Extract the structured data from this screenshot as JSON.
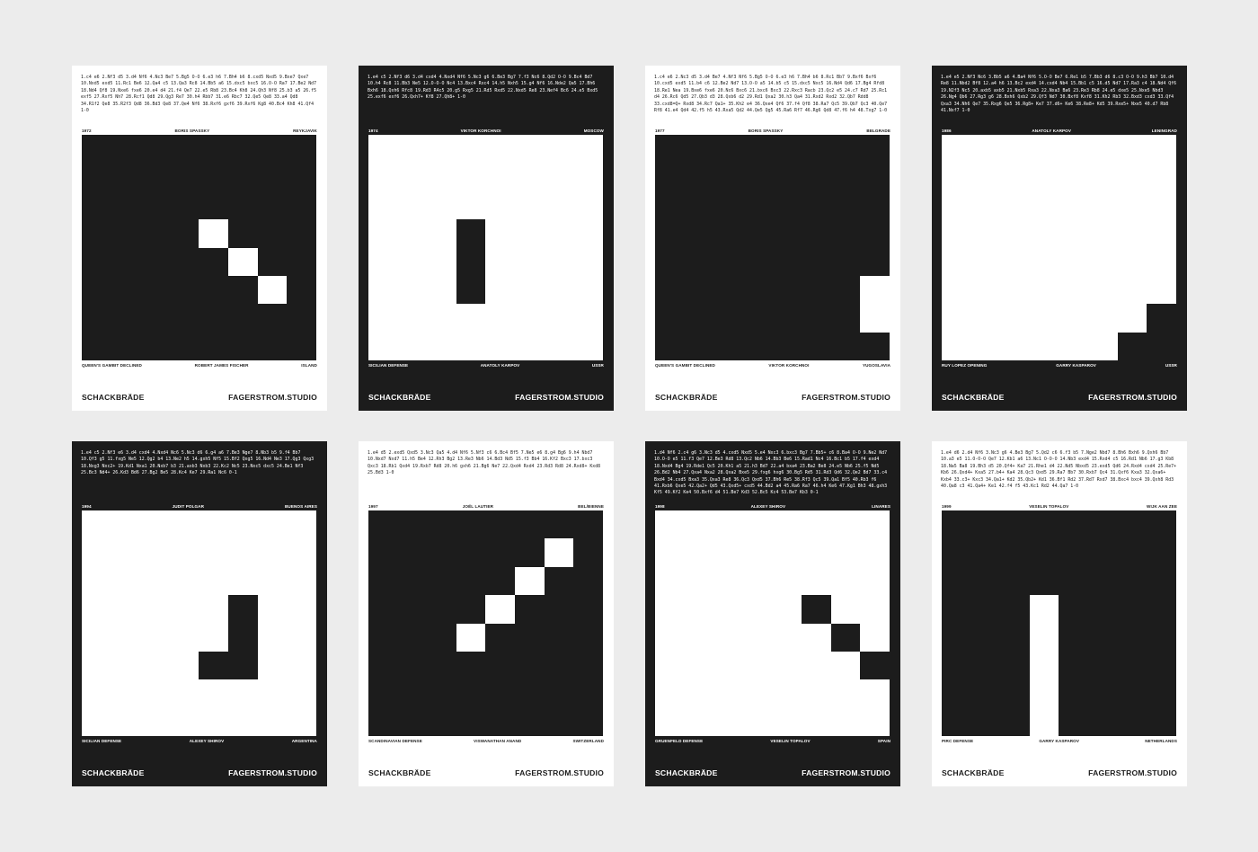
{
  "colors": {
    "background": "#ececec",
    "ink": "#1c1c1c",
    "paper": "#ffffff"
  },
  "posters": [
    {
      "theme": "light",
      "board": "dark",
      "pattern": "pattern-a",
      "moves": "1.c4 e6 2.Nf3 d5 3.d4 Nf6 4.Nc3 Be7 5.Bg5 O-O 6.e3 h6 7.Bh4 b6 8.cxd5 Nxd5 9.Bxe7 Qxe7 10.Nxd5 exd5 11.Rc1 Be6 12.Qa4 c5 13.Qa3 Rc8 14.Bb5 a6 15.dxc5 bxc5 16.O-O Ra7 17.Be2 Nd7 18.Nd4 Qf8 19.Nxe6 fxe6 20.e4 d4 21.f4 Qe7 22.e5 Rb8 23.Bc4 Kh8 24.Qh3 Nf8 25.b3 a5 26.f5 exf5 27.Rxf5 Nh7 28.Rcf1 Qd8 29.Qg3 Re7 30.h4 Rbb7 31.e6 Rbc7 32.Qe5 Qe8 33.a4 Qd8 34.R1f2 Qe8 35.R2f3 Qd8 36.Bd3 Qe8 37.Qe4 Nf6 38.Rxf6 gxf6 39.Rxf6 Kg8 40.Bc4 Kh8 41.Qf4 1-0",
      "year": "1972",
      "player": "Boris Spassky",
      "city": "Reykjavik",
      "opening": "Queen's Gambit Declined",
      "opponent": "Robert James Fischer",
      "country": "Island",
      "brand": "SCHACKBRÄDE",
      "studio": "FAGERSTROM.STUDIO"
    },
    {
      "theme": "dark",
      "board": "light",
      "pattern": "pattern-b",
      "moves": "1.e4 c5 2.Nf3 d6 3.d4 cxd4 4.Nxd4 Nf6 5.Nc3 g6 6.Be3 Bg7 7.f3 Nc6 8.Qd2 O-O 9.Bc4 Bd7 10.h4 Rc8 11.Bb3 Ne5 12.O-O-O Nc4 13.Bxc4 Rxc4 14.h5 Nxh5 15.g4 Nf6 16.Nde2 Qa5 17.Bh6 Bxh6 18.Qxh6 Rfc8 19.Rd3 R4c5 20.g5 Rxg5 21.Rd5 Rxd5 22.Nxd5 Re8 23.Nef4 Bc6 24.e5 Bxd5 25.exf6 exf6 26.Qxh7+ Kf8 27.Qh8+ 1-0",
      "year": "1974",
      "player": "Viktor Korchnoi",
      "city": "Moscow",
      "opening": "Sicilian Defense",
      "opponent": "Anatoly Karpov",
      "country": "USSR",
      "brand": "SCHACKBRÄDE",
      "studio": "FAGERSTROM.STUDIO"
    },
    {
      "theme": "light",
      "board": "dark",
      "pattern": "pattern-c",
      "moves": "1.c4 e6 2.Nc3 d5 3.d4 Be7 4.Nf3 Nf6 5.Bg5 O-O 6.e3 h6 7.Bh4 b6 8.Rc1 Bb7 9.Bxf6 Bxf6 10.cxd5 exd5 11.b4 c6 12.Be2 Nd7 13.O-O a5 14.b5 c5 15.dxc5 Nxc5 16.Nd4 Qd6 17.Bg4 Rfd8 18.Re1 Nea 19.Bxe6 fxe6 20.Nc6 Bxc6 21.bxc6 Bxc3 22.Rxc3 Racb 23.Qc2 e5 24.c7 Rd7 25.Rc1 d4 26.Rc6 Qd5 27.Qb3 d3 28.Qxb6 d2 29.Rd1 Qxa2 30.h3 Qa4 31.Rxd2 Rxd2 32.Qb7 Rdd8 33.cxd8=Q+ Rxd8 34.Rc7 Qa1+ 35.Kh2 e4 36.Qxe4 Qf6 37.f4 Qf8 38.Ra7 Qc5 39.Qb7 Qc3 40.Qe7 Rf8 41.e4 Qd4 42.f5 h5 43.Rxa5 Qd2 44.Qe5 Qg5 45.Ra6 Rf7 46.Rg6 Qd8 47.f6 h4 48.Txg7 1-0",
      "year": "1977",
      "player": "Boris Spassky",
      "city": "Belgrade",
      "opening": "Queen's Gambit Declined",
      "opponent": "Viktor Korchnoi",
      "country": "Yugoslavia",
      "brand": "SCHACKBRÄDE",
      "studio": "FAGERSTROM.STUDIO"
    },
    {
      "theme": "dark",
      "board": "light",
      "pattern": "pattern-d",
      "moves": "1.e4 e5 2.Nf3 Nc6 3.Bb5 a6 4.Ba4 Nf6 5.O-O Be7 6.Re1 b5 7.Bb3 d6 8.c3 O-O 9.h3 Bb7 10.d4 Re8 11.Nbd2 Bf8 12.a4 h6 13.Bc2 exd4 14.cxd4 Nb4 15.Bb1 c5 16.d5 Nd7 17.Ra3 c4 18.Nd4 Qf6 19.N2f3 Nc5 20.axb5 axb5 21.Nxb5 Rxa3 22.Nxa3 Ba6 23.Re3 Rb8 24.e5 dxe5 25.Nxe5 Nbd3 26.Ng4 Qb6 27.Rg3 g6 28.Bxh6 Qxb2 29.Qf3 Nd7 30.Bxf8 Kxf8 31.Kh2 Rb3 32.Bxd3 cxd3 33.Qf4 Qxa3 34.Nh6 Qe7 35.Rxg6 Qe5 36.Rg8+ Ke7 37.d6+ Ke6 38.Re8+ Kd5 39.Rxe5+ Nxe5 40.d7 Rb8 41.Nxf7 1-0",
      "year": "1986",
      "player": "Anatoly Karpov",
      "city": "Leningrad",
      "opening": "Ruy Lopez Opening",
      "opponent": "Garry Kasparov",
      "country": "USSR",
      "brand": "SCHACKBRÄDE",
      "studio": "FAGERSTROM.STUDIO"
    },
    {
      "theme": "dark",
      "board": "light",
      "pattern": "pattern-e",
      "moves": "1.e4 c5 2.Nf3 e6 3.d4 cxd4 4.Nxd4 Nc6 5.Nc3 d6 6.g4 a6 7.Be3 Nge7 8.Nb3 b5 9.f4 Bb7 10.Qf3 g5 11.fxg5 Ne5 12.Qg2 b4 13.Ne2 h5 14.gxh5 Nf5 15.Bf2 Qxg5 16.Nd4 Ne3 17.Qg3 Qxg3 18.Nxg3 Nxc2+ 19.Kd1 Nxa1 20.Nxb7 b3 21.axb3 Nxb3 22.Kc2 Nc5 23.Nxc5 dxc5 24.Be1 Nf3 25.Bc3 Nd4+ 26.Kd3 Bd6 27.Bg2 Be5 28.Kc4 Ke7 29.Ra1 Nc6 0-1",
      "year": "1994",
      "player": "Judit Polgar",
      "city": "Buenos Aires",
      "opening": "Sicilian Defense",
      "opponent": "Alexey Shirov",
      "country": "Argentina",
      "brand": "SCHACKBRÄDE",
      "studio": "FAGERSTROM.STUDIO"
    },
    {
      "theme": "light",
      "board": "dark",
      "pattern": "pattern-f",
      "moves": "1.e4 d5 2.exd5 Qxd5 3.Nc3 Qa5 4.d4 Nf6 5.Nf3 c6 6.Bc4 Bf5 7.Ne5 e6 8.g4 Bg6 9.h4 Nbd7 10.Nxd7 Nxd7 11.h5 Be4 12.Rh3 Bg2 13.Re3 Nb6 14.Bd3 Nd5 15.f3 Bb4 16.Kf2 Bxc3 17.bxc3 Qxc3 18.Rb1 Qxd4 19.Rxb7 Rd8 20.h6 gxh6 21.Bg6 Ne7 22.Qxd4 Rxd4 23.Rd3 Rd8 24.Rxd8+ Kxd8 25.Bd3 1-0",
      "year": "1997",
      "player": "Joël Lautier",
      "city": "Bel/Bienne",
      "opening": "Scandinavian Defense",
      "opponent": "Viswanathan Anand",
      "country": "Switzerland",
      "brand": "SCHACKBRÄDE",
      "studio": "FAGERSTROM.STUDIO"
    },
    {
      "theme": "dark",
      "board": "light",
      "pattern": "pattern-g",
      "moves": "1.d4 Nf6 2.c4 g6 3.Nc3 d5 4.cxd5 Nxd5 5.e4 Nxc3 6.bxc3 Bg7 7.Bb5+ c6 8.Ba4 O-O 9.Ne2 Nd7 10.O-O e5 11.f3 Qe7 12.Be3 Rd8 13.Qc2 Nb6 14.Bb3 Be6 15.Rad1 Nc4 16.Bc1 b5 17.f4 exd4 18.Nxd4 Bg4 19.Rde1 Qc5 20.Kh1 a5 21.h3 Bd7 22.a4 bxa4 23.Ba2 Be8 24.e5 Nb6 25.f5 Nd5 26.Bd2 Nb4 27.Qxa4 Nxa2 28.Qxa2 Bxe5 29.fxg6 hxg6 30.Bg5 Rd5 31.Rd3 Qd6 32.Qe2 Bd7 33.c4 Bxd4 34.cxd5 Bxa3 35.Qxa3 Re8 36.Qc3 Qxd5 37.Bh6 Re5 38.Rf3 Qc5 39.Qa1 Bf5 40.Rb3 f6 41.Rxb6 Qxe5 42.Qa2+ Qd5 43.Qxd5+ cxd5 44.Bd2 a4 45.Ra6 Ra7 46.h4 Ke6 47.Kg1 Bh3 48.gxh3 Kf5 49.Kf2 Ke4 50.Bxf6 d4 51.Be7 Kd3 52.Bc5 Kc4 53.Be7 Kb3 0-1",
      "year": "1998",
      "player": "Alexey Shirov",
      "city": "Linares",
      "opening": "Gruenfeld Defense",
      "opponent": "Veselin Topalov",
      "country": "Spain",
      "brand": "SCHACKBRÄDE",
      "studio": "FAGERSTROM.STUDIO"
    },
    {
      "theme": "light",
      "board": "dark",
      "pattern": "pattern-h",
      "moves": "1.e4 d6 2.d4 Nf6 3.Nc3 g6 4.Be3 Bg7 5.Qd2 c6 6.f3 b5 7.Nge2 Nbd7 8.Bh6 Bxh6 9.Qxh6 Bb7 10.a3 e5 11.O-O-O Qe7 12.Kb1 a6 13.Nc1 O-O-O 14.Nb3 exd4 15.Rxd4 c5 16.Rd1 Nb6 17.g3 Kb8 18.Na5 Ba8 19.Bh3 d5 20.Qf4+ Ka7 21.Rhe1 d4 22.Nd5 Nbxd5 23.exd5 Qd6 24.Rxd4 cxd4 25.Re7+ Kb6 26.Qxd4+ Kxa5 27.b4+ Ka4 28.Qc3 Qxd5 29.Ra7 Bb7 30.Rxb7 Qc4 31.Qxf6 Kxa3 32.Qxa6+ Kxb4 33.c3+ Kxc3 34.Qa1+ Kd2 35.Qb2+ Kd1 36.Bf1 Rd2 37.Rd7 Rxd7 38.Bxc4 bxc4 39.Qxh8 Rd3 40.Qa8 c3 41.Qa4+ Ke1 42.f4 f5 43.Kc1 Rd2 44.Qa7 1-0",
      "year": "1999",
      "player": "Veselin Topalov",
      "city": "Wijk aan Zee",
      "opening": "Pirc Defense",
      "opponent": "Garry Kasparov",
      "country": "Netherlands",
      "brand": "SCHACKBRÄDE",
      "studio": "FAGERSTROM.STUDIO"
    }
  ]
}
